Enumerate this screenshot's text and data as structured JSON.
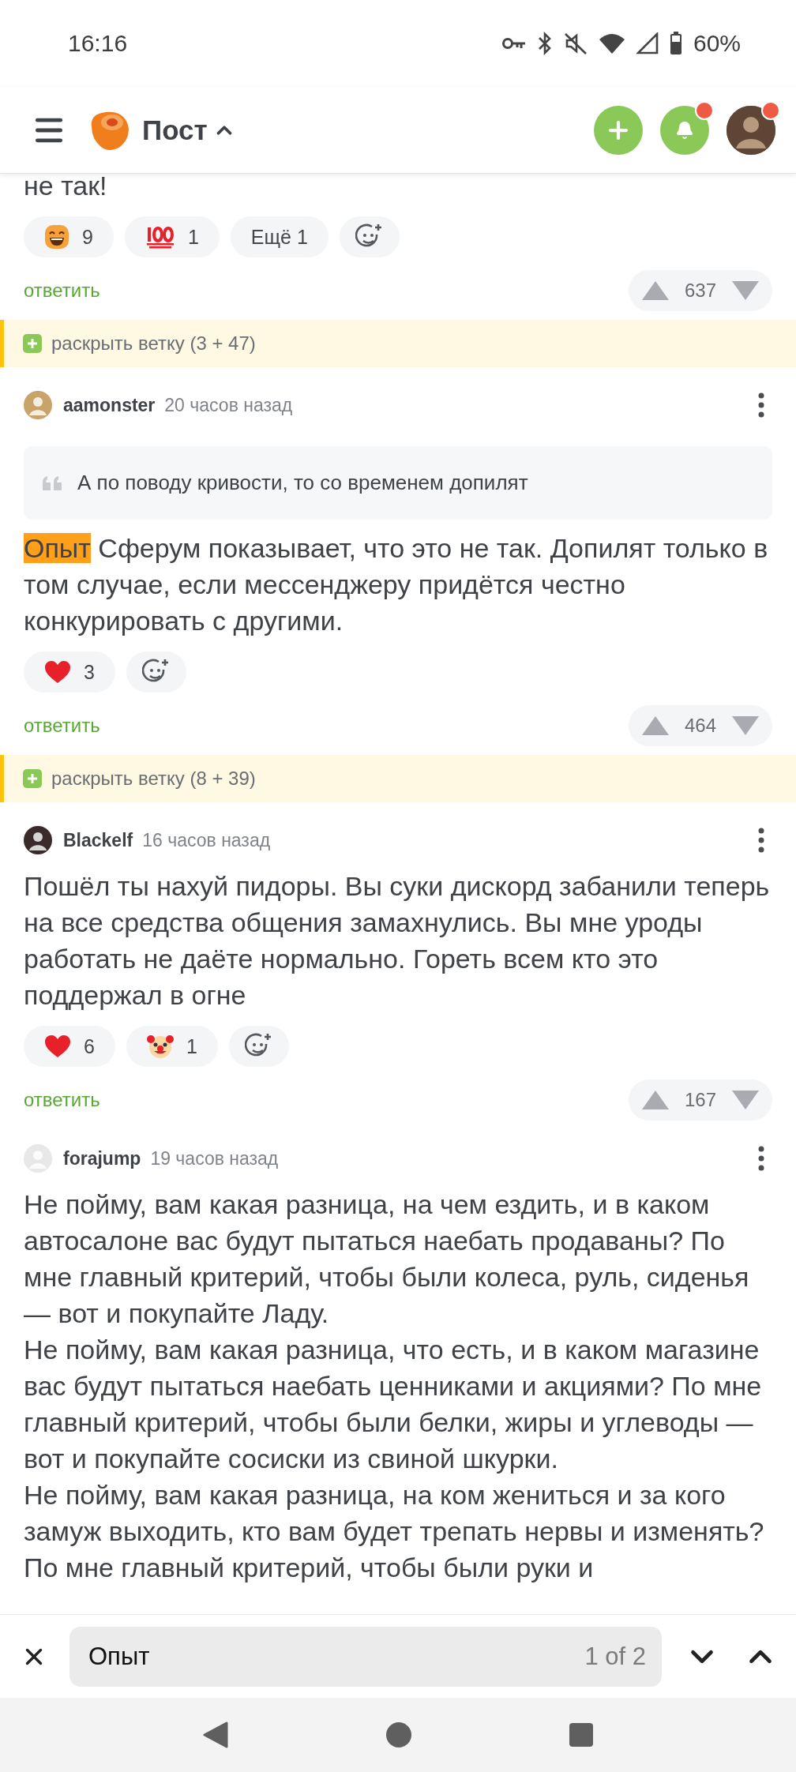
{
  "status_bar": {
    "time": "16:16",
    "battery": "60%"
  },
  "header": {
    "title": "Пост",
    "notifications_badge": true,
    "profile_badge": true
  },
  "comments": [
    {
      "kind": "tail",
      "paragraphs": [
        [
          {
            "text": "не так!",
            "highlighted": false
          }
        ]
      ],
      "reactions": [
        {
          "kind": "grin",
          "count": "9"
        },
        {
          "kind": "hundred",
          "count": "1"
        },
        {
          "kind": "more",
          "label": "Ещё 1"
        },
        {
          "kind": "add"
        }
      ],
      "reply": "ответить",
      "votes": "637",
      "branch": "раскрыть ветку (3 + 47)"
    },
    {
      "kind": "full",
      "author": "aamonster",
      "time": "20 часов назад",
      "quote": "А по поводу кривости, то со временем допилят",
      "paragraphs": [
        [
          {
            "text": "Опыт",
            "highlighted": true
          },
          {
            "text": " Сферум показывает, что это не так. Допилят только в том случае, если мессенджеру придётся честно конкурировать с другими.",
            "highlighted": false
          }
        ]
      ],
      "reactions": [
        {
          "kind": "heart",
          "count": "3"
        },
        {
          "kind": "add"
        }
      ],
      "reply": "ответить",
      "votes": "464",
      "branch": "раскрыть ветку (8 + 39)"
    },
    {
      "kind": "full",
      "author": "Blackelf",
      "time": "16 часов назад",
      "paragraphs": [
        [
          {
            "text": "Пошёл ты нахуй пидоры. Вы суки дискорд забанили теперь на все средства общения замахнулись. Вы мне уроды работать не даёте нормально. Гореть всем кто это поддержал в огне",
            "highlighted": false
          }
        ]
      ],
      "reactions": [
        {
          "kind": "heart",
          "count": "6"
        },
        {
          "kind": "clown",
          "count": "1"
        },
        {
          "kind": "add"
        }
      ],
      "reply": "ответить",
      "votes": "167"
    },
    {
      "kind": "full",
      "author": "forajump",
      "time": "19 часов назад",
      "paragraphs": [
        [
          {
            "text": "Не пойму, вам какая разница, на чем ездить, и в каком автосалоне вас будут пытаться наебать продаваны? По мне главный критерий, чтобы были колеса, руль, сиденья — вот и покупайте Ладу.",
            "highlighted": false
          }
        ],
        [
          {
            "text": "Не пойму, вам какая разница, что есть, и в каком магазине вас будут пытаться наебать ценниками и акциями? По мне главный критерий, чтобы были белки, жиры и углеводы — вот и покупайте сосиски из свиной шкурки.",
            "highlighted": false
          }
        ],
        [
          {
            "text": "Не пойму, вам какая разница, на ком жениться и за кого замуж выходить, кто вам будет трепать нервы и изменять? По мне главный критерий, чтобы были руки и",
            "highlighted": false
          }
        ]
      ]
    }
  ],
  "find_bar": {
    "query": "Опыт",
    "match_count": "1 of 2"
  }
}
